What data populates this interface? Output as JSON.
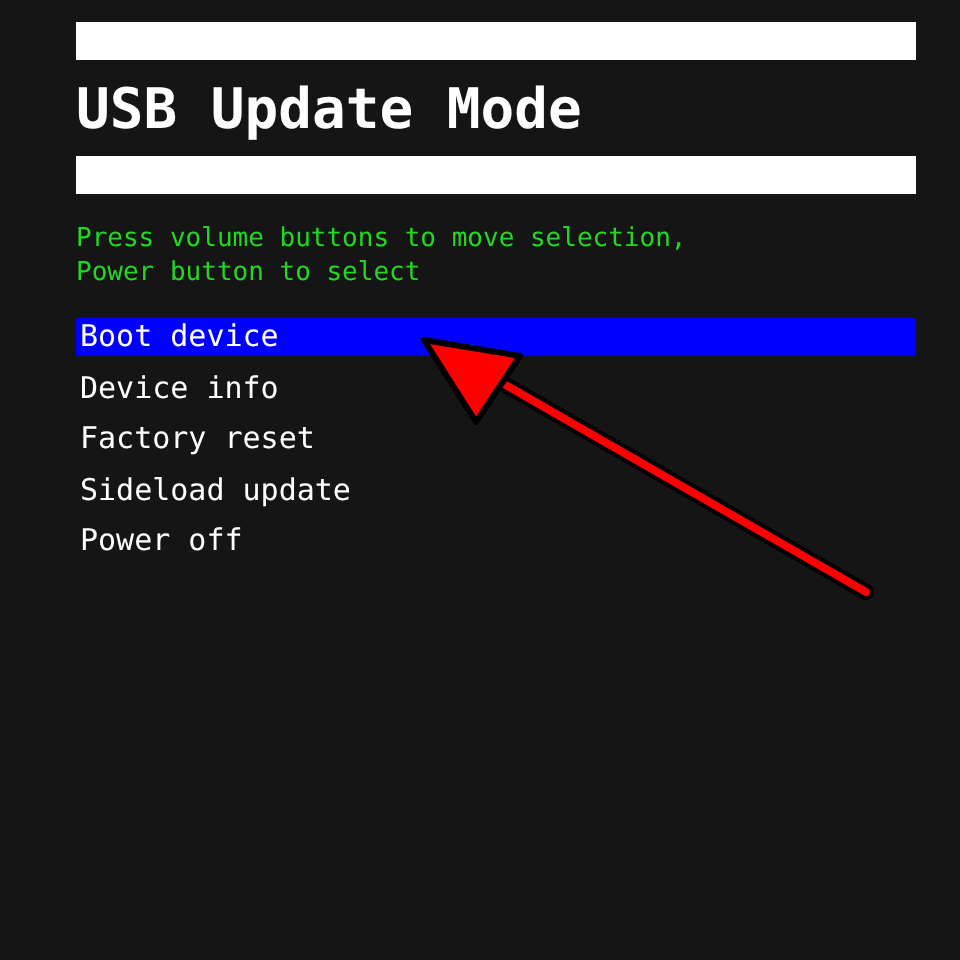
{
  "title": "USB Update Mode",
  "instructions": [
    "Press volume buttons to move selection,",
    "Power button to select"
  ],
  "menu": [
    {
      "label": "Boot device",
      "selected": true
    },
    {
      "label": "Device info",
      "selected": false
    },
    {
      "label": "Factory reset",
      "selected": false
    },
    {
      "label": "Sideload update",
      "selected": false
    },
    {
      "label": "Power off",
      "selected": false
    }
  ]
}
